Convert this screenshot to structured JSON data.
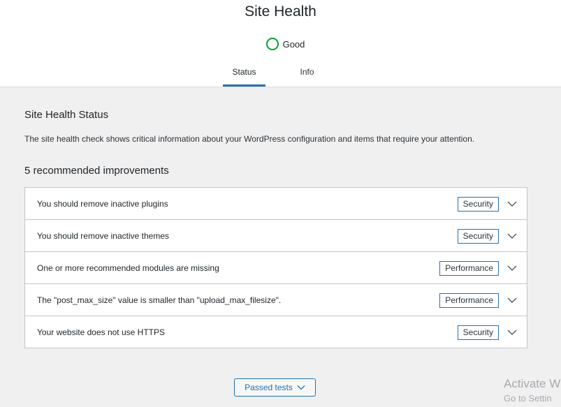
{
  "header": {
    "title": "Site Health",
    "status_label": "Good",
    "status_color": "#00a32a",
    "tabs": [
      {
        "label": "Status",
        "active": true
      },
      {
        "label": "Info",
        "active": false
      }
    ]
  },
  "main": {
    "section_title": "Site Health Status",
    "description": "The site health check shows critical information about your WordPress configuration and items that require your attention.",
    "issues_heading": "5 recommended improvements",
    "issues": [
      {
        "label": "You should remove inactive plugins",
        "badge": "Security"
      },
      {
        "label": "You should remove inactive themes",
        "badge": "Security"
      },
      {
        "label": "One or more recommended modules are missing",
        "badge": "Performance"
      },
      {
        "label": "The \"post_max_size\" value is smaller than \"upload_max_filesize\".",
        "badge": "Performance"
      },
      {
        "label": "Your website does not use HTTPS",
        "badge": "Security"
      }
    ],
    "passed_tests_label": "Passed tests"
  },
  "watermark": {
    "line1": "Activate W",
    "line2": "Go to Settin"
  },
  "colors": {
    "accent": "#2271b1",
    "good": "#00a32a"
  }
}
